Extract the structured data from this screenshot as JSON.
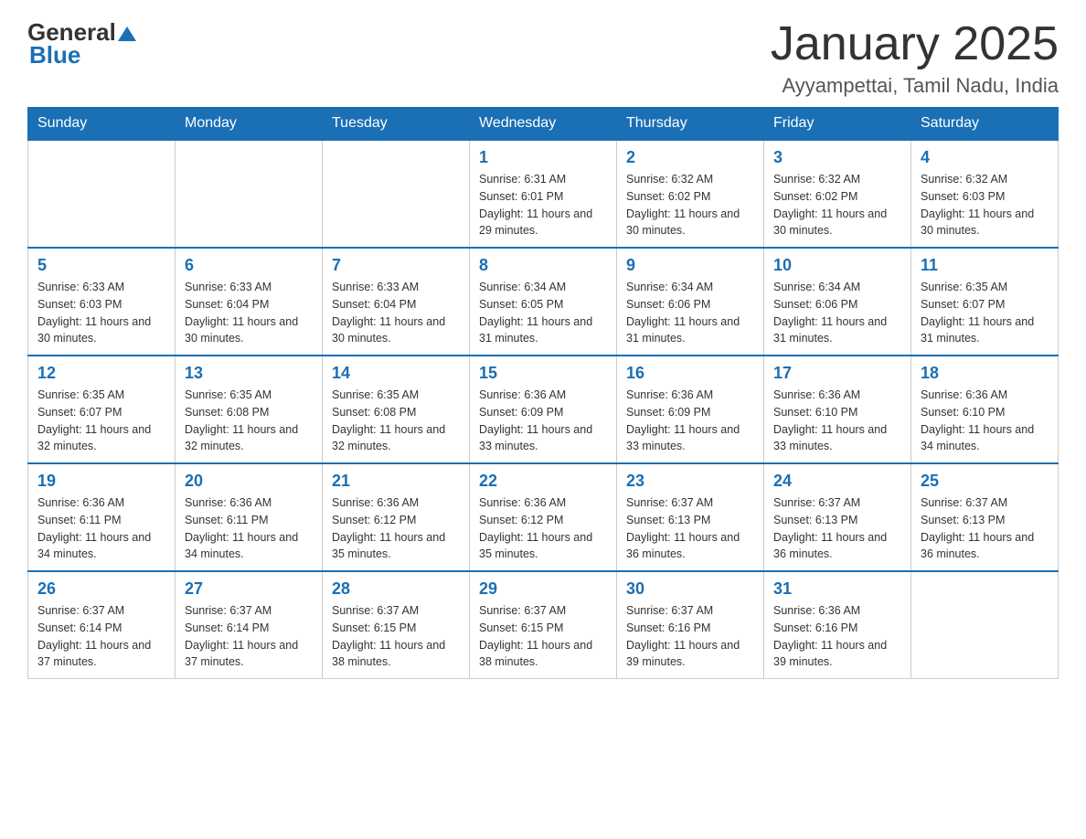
{
  "header": {
    "logo": {
      "general": "General",
      "blue": "Blue"
    },
    "title": "January 2025",
    "subtitle": "Ayyampettai, Tamil Nadu, India"
  },
  "calendar": {
    "days_of_week": [
      "Sunday",
      "Monday",
      "Tuesday",
      "Wednesday",
      "Thursday",
      "Friday",
      "Saturday"
    ],
    "weeks": [
      [
        {
          "day": "",
          "info": ""
        },
        {
          "day": "",
          "info": ""
        },
        {
          "day": "",
          "info": ""
        },
        {
          "day": "1",
          "info": "Sunrise: 6:31 AM\nSunset: 6:01 PM\nDaylight: 11 hours and 29 minutes."
        },
        {
          "day": "2",
          "info": "Sunrise: 6:32 AM\nSunset: 6:02 PM\nDaylight: 11 hours and 30 minutes."
        },
        {
          "day": "3",
          "info": "Sunrise: 6:32 AM\nSunset: 6:02 PM\nDaylight: 11 hours and 30 minutes."
        },
        {
          "day": "4",
          "info": "Sunrise: 6:32 AM\nSunset: 6:03 PM\nDaylight: 11 hours and 30 minutes."
        }
      ],
      [
        {
          "day": "5",
          "info": "Sunrise: 6:33 AM\nSunset: 6:03 PM\nDaylight: 11 hours and 30 minutes."
        },
        {
          "day": "6",
          "info": "Sunrise: 6:33 AM\nSunset: 6:04 PM\nDaylight: 11 hours and 30 minutes."
        },
        {
          "day": "7",
          "info": "Sunrise: 6:33 AM\nSunset: 6:04 PM\nDaylight: 11 hours and 30 minutes."
        },
        {
          "day": "8",
          "info": "Sunrise: 6:34 AM\nSunset: 6:05 PM\nDaylight: 11 hours and 31 minutes."
        },
        {
          "day": "9",
          "info": "Sunrise: 6:34 AM\nSunset: 6:06 PM\nDaylight: 11 hours and 31 minutes."
        },
        {
          "day": "10",
          "info": "Sunrise: 6:34 AM\nSunset: 6:06 PM\nDaylight: 11 hours and 31 minutes."
        },
        {
          "day": "11",
          "info": "Sunrise: 6:35 AM\nSunset: 6:07 PM\nDaylight: 11 hours and 31 minutes."
        }
      ],
      [
        {
          "day": "12",
          "info": "Sunrise: 6:35 AM\nSunset: 6:07 PM\nDaylight: 11 hours and 32 minutes."
        },
        {
          "day": "13",
          "info": "Sunrise: 6:35 AM\nSunset: 6:08 PM\nDaylight: 11 hours and 32 minutes."
        },
        {
          "day": "14",
          "info": "Sunrise: 6:35 AM\nSunset: 6:08 PM\nDaylight: 11 hours and 32 minutes."
        },
        {
          "day": "15",
          "info": "Sunrise: 6:36 AM\nSunset: 6:09 PM\nDaylight: 11 hours and 33 minutes."
        },
        {
          "day": "16",
          "info": "Sunrise: 6:36 AM\nSunset: 6:09 PM\nDaylight: 11 hours and 33 minutes."
        },
        {
          "day": "17",
          "info": "Sunrise: 6:36 AM\nSunset: 6:10 PM\nDaylight: 11 hours and 33 minutes."
        },
        {
          "day": "18",
          "info": "Sunrise: 6:36 AM\nSunset: 6:10 PM\nDaylight: 11 hours and 34 minutes."
        }
      ],
      [
        {
          "day": "19",
          "info": "Sunrise: 6:36 AM\nSunset: 6:11 PM\nDaylight: 11 hours and 34 minutes."
        },
        {
          "day": "20",
          "info": "Sunrise: 6:36 AM\nSunset: 6:11 PM\nDaylight: 11 hours and 34 minutes."
        },
        {
          "day": "21",
          "info": "Sunrise: 6:36 AM\nSunset: 6:12 PM\nDaylight: 11 hours and 35 minutes."
        },
        {
          "day": "22",
          "info": "Sunrise: 6:36 AM\nSunset: 6:12 PM\nDaylight: 11 hours and 35 minutes."
        },
        {
          "day": "23",
          "info": "Sunrise: 6:37 AM\nSunset: 6:13 PM\nDaylight: 11 hours and 36 minutes."
        },
        {
          "day": "24",
          "info": "Sunrise: 6:37 AM\nSunset: 6:13 PM\nDaylight: 11 hours and 36 minutes."
        },
        {
          "day": "25",
          "info": "Sunrise: 6:37 AM\nSunset: 6:13 PM\nDaylight: 11 hours and 36 minutes."
        }
      ],
      [
        {
          "day": "26",
          "info": "Sunrise: 6:37 AM\nSunset: 6:14 PM\nDaylight: 11 hours and 37 minutes."
        },
        {
          "day": "27",
          "info": "Sunrise: 6:37 AM\nSunset: 6:14 PM\nDaylight: 11 hours and 37 minutes."
        },
        {
          "day": "28",
          "info": "Sunrise: 6:37 AM\nSunset: 6:15 PM\nDaylight: 11 hours and 38 minutes."
        },
        {
          "day": "29",
          "info": "Sunrise: 6:37 AM\nSunset: 6:15 PM\nDaylight: 11 hours and 38 minutes."
        },
        {
          "day": "30",
          "info": "Sunrise: 6:37 AM\nSunset: 6:16 PM\nDaylight: 11 hours and 39 minutes."
        },
        {
          "day": "31",
          "info": "Sunrise: 6:36 AM\nSunset: 6:16 PM\nDaylight: 11 hours and 39 minutes."
        },
        {
          "day": "",
          "info": ""
        }
      ]
    ]
  }
}
